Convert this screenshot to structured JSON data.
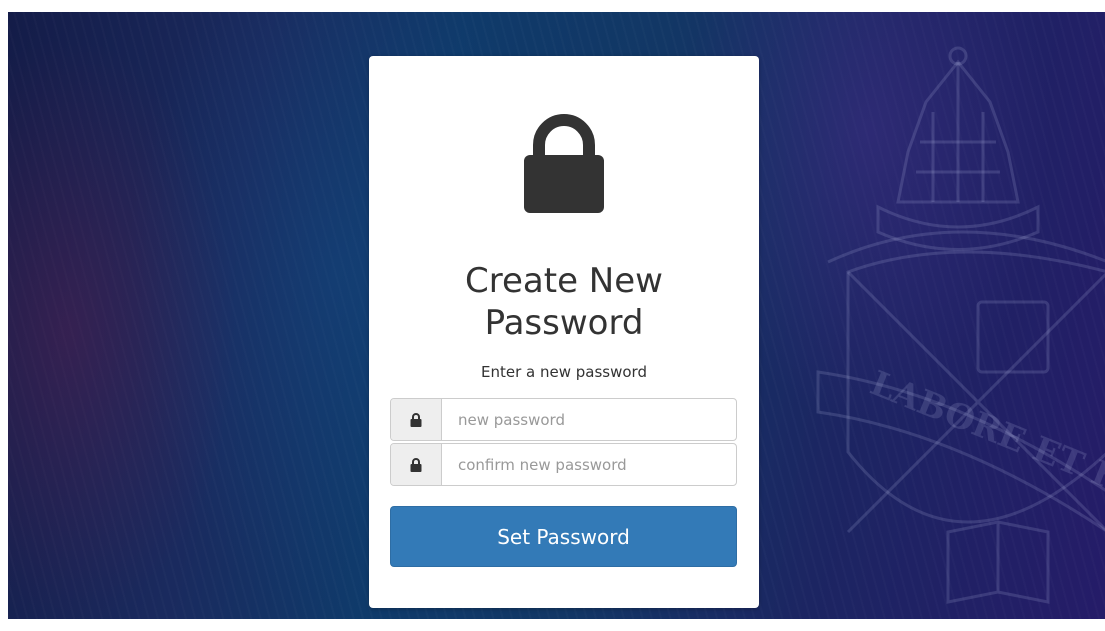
{
  "form": {
    "title_line1": "Create New",
    "title_line2": "Password",
    "subtitle": "Enter a new password",
    "new_password_placeholder": "new password",
    "confirm_password_placeholder": "confirm new password",
    "new_password_value": "",
    "confirm_password_value": "",
    "submit_label": "Set Password"
  },
  "background": {
    "crest_motto": "LABORE ET HONORE"
  },
  "icons": {
    "hero": "padlock-icon",
    "field_addon": "padlock-icon"
  },
  "colors": {
    "primary_button": "#337ab7",
    "icon_dark": "#333333",
    "addon_bg": "#eeeeee"
  }
}
